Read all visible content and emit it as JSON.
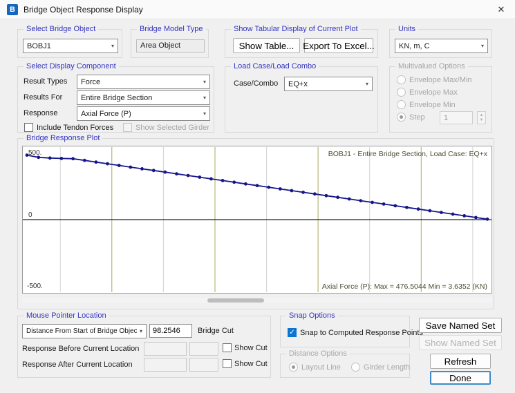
{
  "window": {
    "title": "Bridge Object Response Display",
    "icon_letter": "B"
  },
  "icons": {
    "close": "✕",
    "chevron_down": "▾",
    "check": "✓",
    "spinner_up": "▲",
    "spinner_down": "▼"
  },
  "colors": {
    "accent_blue": "#3434c0",
    "plot_line": "#16168c",
    "grid_olive": "#a9a95e",
    "grid_gray": "#d2d2d2",
    "check_blue": "#0b76d1"
  },
  "groups": {
    "select_bridge_object": {
      "label": "Select Bridge Object",
      "value": "BOBJ1"
    },
    "bridge_model_type": {
      "label": "Bridge Model Type",
      "value": "Area Object"
    },
    "tabular": {
      "label": "Show Tabular Display of Current Plot",
      "show_table": "Show Table...",
      "export_excel": "Export To Excel..."
    },
    "units": {
      "label": "Units",
      "value": "KN, m, C"
    },
    "display_component": {
      "label": "Select Display Component",
      "rows": [
        {
          "label": "Result Types",
          "value": "Force"
        },
        {
          "label": "Results For",
          "value": "Entire Bridge Section"
        },
        {
          "label": "Response",
          "value": "Axial Force  (P)"
        }
      ],
      "include_tendon": "Include Tendon Forces",
      "show_selected_girder": "Show Selected Girder"
    },
    "load_case": {
      "label": "Load Case/Load Combo",
      "case_label": "Case/Combo",
      "value": "EQ+x"
    },
    "multivalued": {
      "label": "Multivalued Options",
      "options": [
        "Envelope Max/Min",
        "Envelope Max",
        "Envelope Min",
        "Step"
      ],
      "step_value": "1"
    },
    "plot": {
      "label": "Bridge Response Plot",
      "top_annotation": "BOBJ1 - Entire Bridge Section,  Load Case: EQ+x",
      "bottom_annotation": "Axial Force  (P):  Max = 476.5044   Min = 3.6352  (KN)",
      "y_top": "500.",
      "y_zero": "0",
      "y_bottom": "-500."
    },
    "mouse": {
      "label": "Mouse Pointer Location",
      "mode_value": "Distance From Start of Bridge Object",
      "distance_value": "98.2546",
      "bridge_cut": "Bridge Cut",
      "before_label": "Response Before Current Location",
      "after_label": "Response After Current Location",
      "show_cut": "Show Cut"
    },
    "snap": {
      "label": "Snap Options",
      "option": "Snap to Computed Response Points"
    },
    "distance_options": {
      "label": "Distance Options",
      "options": [
        "Layout Line",
        "Girder Length"
      ]
    },
    "buttons": {
      "save_named_set": "Save Named Set",
      "show_named_set": "Show Named Set",
      "refresh": "Refresh",
      "done": "Done"
    }
  },
  "chart_data": {
    "type": "line",
    "title": "BOBJ1 - Entire Bridge Section, Load Case: EQ+x",
    "ylabel": "Axial Force (P) (KN)",
    "ylim": [
      -500,
      500
    ],
    "y_ticks": [
      500,
      0,
      -500
    ],
    "max": 476.5044,
    "min": 3.6352,
    "legend": [],
    "grid": "vertical",
    "x_percent": [
      0,
      2.5,
      5,
      7.5,
      10,
      12.5,
      15,
      17.5,
      20,
      22.5,
      25,
      27.5,
      30,
      32.5,
      35,
      37.5,
      40,
      42.5,
      45,
      47.5,
      50,
      52.5,
      55,
      57.5,
      60,
      62.5,
      65,
      67.5,
      70,
      72.5,
      75,
      77.5,
      80,
      82.5,
      85,
      87.5,
      90,
      92.5,
      95,
      97.5,
      100
    ],
    "y_values": [
      476.5,
      460,
      455,
      452,
      450,
      437.6,
      425.2,
      412.8,
      400.4,
      388,
      375.6,
      363.2,
      350.8,
      338.4,
      326,
      313.6,
      301.2,
      288.8,
      276.4,
      264,
      251.6,
      239.2,
      226.8,
      214.4,
      202,
      189.6,
      177.2,
      164.8,
      152.4,
      140,
      127.6,
      115.2,
      102.8,
      90.4,
      78,
      65.6,
      53.2,
      40.8,
      28.4,
      16,
      3.6
    ],
    "gridlines_x_fraction": [
      0.08,
      0.19,
      0.3,
      0.41,
      0.52,
      0.63,
      0.74,
      0.85,
      0.96
    ],
    "gridline_colors": [
      "gray",
      "olive",
      "gray",
      "olive",
      "gray",
      "olive",
      "gray",
      "olive",
      "gray"
    ]
  }
}
